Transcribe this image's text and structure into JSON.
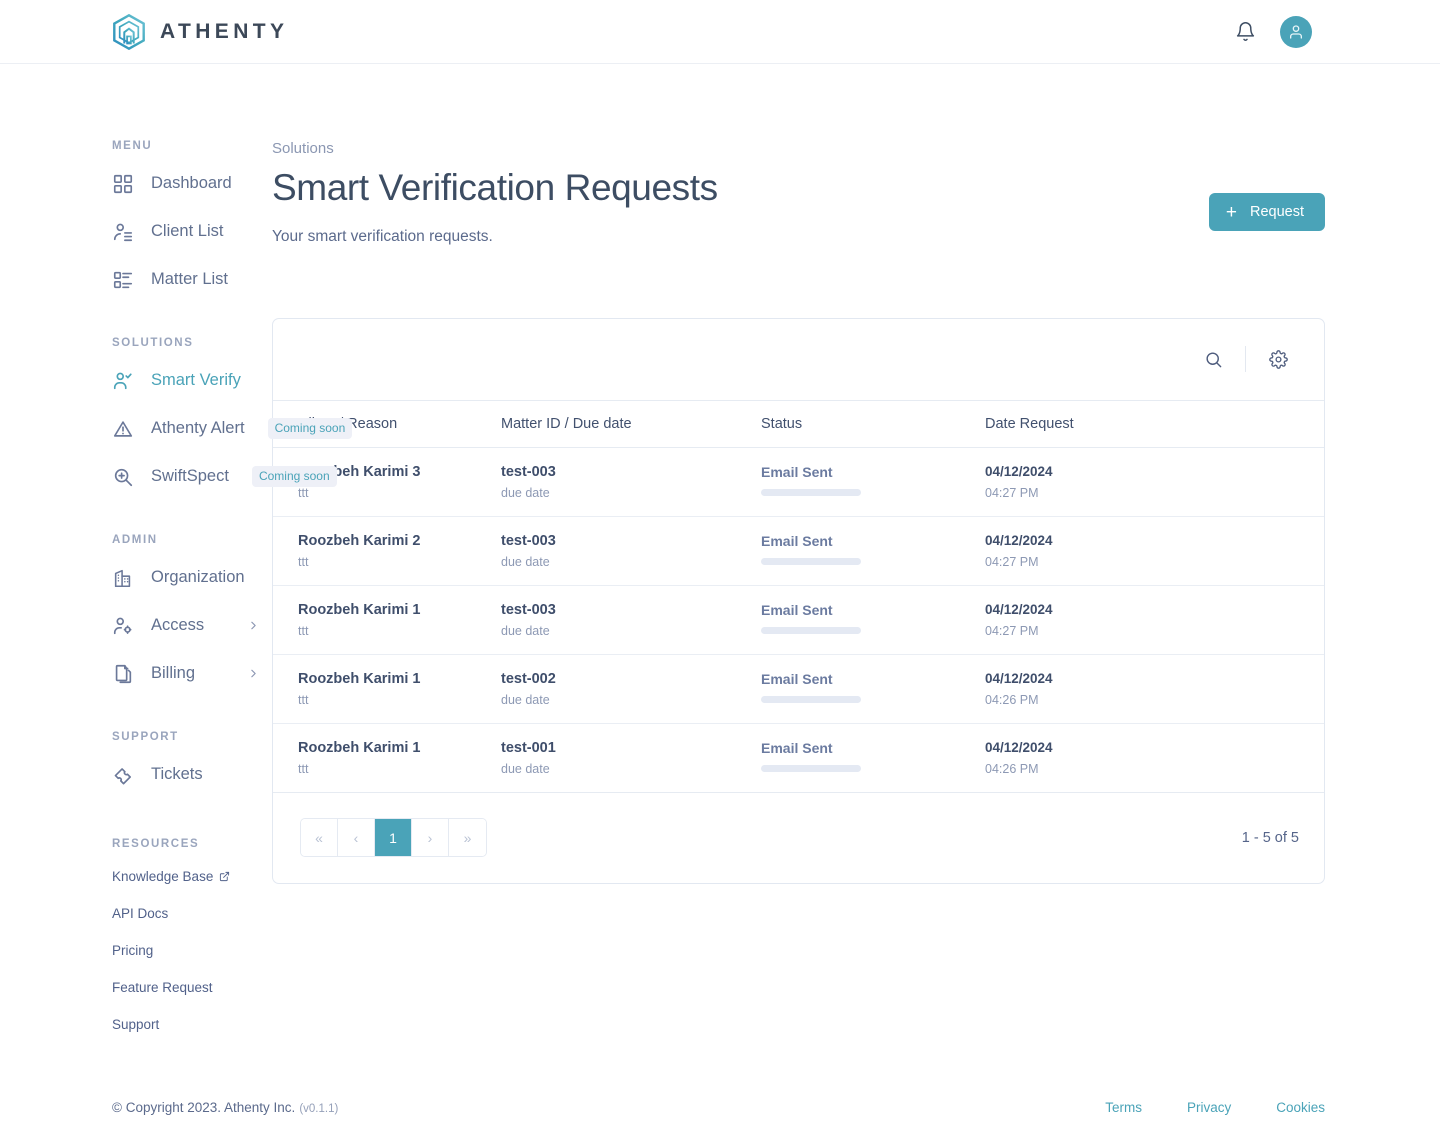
{
  "brand": {
    "name": "ATHENTY",
    "logo_icon": "athenty-hexagon-house-logo"
  },
  "topbar": {
    "notifications_icon": "bell-icon",
    "avatar_icon": "user-avatar-icon"
  },
  "sidebar": {
    "groups": [
      {
        "title": "MENU",
        "items": [
          {
            "label": "Dashboard",
            "icon": "grid-icon",
            "active": false
          },
          {
            "label": "Client List",
            "icon": "user-list-icon",
            "active": false
          },
          {
            "label": "Matter List",
            "icon": "list-items-icon",
            "active": false
          }
        ]
      },
      {
        "title": "SOLUTIONS",
        "items": [
          {
            "label": "Smart Verify",
            "icon": "user-check-icon",
            "active": true
          },
          {
            "label": "Athenty Alert",
            "icon": "warning-triangle-icon",
            "active": false,
            "badge": "Coming soon"
          },
          {
            "label": "SwiftSpect",
            "icon": "magnifier-plus-icon",
            "active": false,
            "badge": "Coming soon"
          }
        ]
      },
      {
        "title": "ADMIN",
        "items": [
          {
            "label": "Organization",
            "icon": "building-icon",
            "active": false
          },
          {
            "label": "Access",
            "icon": "user-gear-icon",
            "active": false,
            "chevron": "chevron-right-icon"
          },
          {
            "label": "Billing",
            "icon": "documents-icon",
            "active": false,
            "chevron": "chevron-right-icon"
          }
        ]
      },
      {
        "title": "SUPPORT",
        "items": [
          {
            "label": "Tickets",
            "icon": "ticket-icon",
            "active": false
          }
        ]
      }
    ],
    "resources": {
      "title": "RESOURCES",
      "links": [
        {
          "label": "Knowledge Base",
          "external_icon": "external-link-icon"
        },
        {
          "label": "API Docs"
        },
        {
          "label": "Pricing"
        },
        {
          "label": "Feature Request"
        },
        {
          "label": "Support"
        }
      ]
    }
  },
  "main": {
    "breadcrumb": "Solutions",
    "title": "Smart Verification Requests",
    "subtitle": "Your smart verification requests.",
    "request_button": {
      "label": "Request",
      "icon": "plus-icon"
    },
    "toolbar": {
      "search_icon": "search-icon",
      "settings_icon": "gear-icon"
    },
    "table": {
      "columns": [
        "Client / Reason",
        "Matter ID / Due date",
        "Status",
        "Date Request"
      ],
      "rows": [
        {
          "client": "Roozbeh Karimi 3",
          "reason": "ttt",
          "matter": "test-003",
          "due": "due date",
          "status": "Email Sent",
          "date": "04/12/2024",
          "time": "04:27 PM"
        },
        {
          "client": "Roozbeh Karimi 2",
          "reason": "ttt",
          "matter": "test-003",
          "due": "due date",
          "status": "Email Sent",
          "date": "04/12/2024",
          "time": "04:27 PM"
        },
        {
          "client": "Roozbeh Karimi 1",
          "reason": "ttt",
          "matter": "test-003",
          "due": "due date",
          "status": "Email Sent",
          "date": "04/12/2024",
          "time": "04:27 PM"
        },
        {
          "client": "Roozbeh Karimi 1",
          "reason": "ttt",
          "matter": "test-002",
          "due": "due date",
          "status": "Email Sent",
          "date": "04/12/2024",
          "time": "04:26 PM"
        },
        {
          "client": "Roozbeh Karimi 1",
          "reason": "ttt",
          "matter": "test-001",
          "due": "due date",
          "status": "Email Sent",
          "date": "04/12/2024",
          "time": "04:26 PM"
        }
      ]
    },
    "pagination": {
      "first": "«",
      "prev": "‹",
      "current": "1",
      "next": "›",
      "last": "»",
      "count_label": "1 - 5 of 5"
    }
  },
  "footer": {
    "copyright": "© Copyright 2023. Athenty Inc.",
    "version": "(v0.1.1)",
    "links": [
      "Terms",
      "Privacy",
      "Cookies"
    ]
  },
  "colors": {
    "accent": "#4aa3b8",
    "text": "#3f4e6b",
    "muted": "#8d99b4",
    "border": "#e2e8f1",
    "badge_bg": "#eef0f7"
  }
}
